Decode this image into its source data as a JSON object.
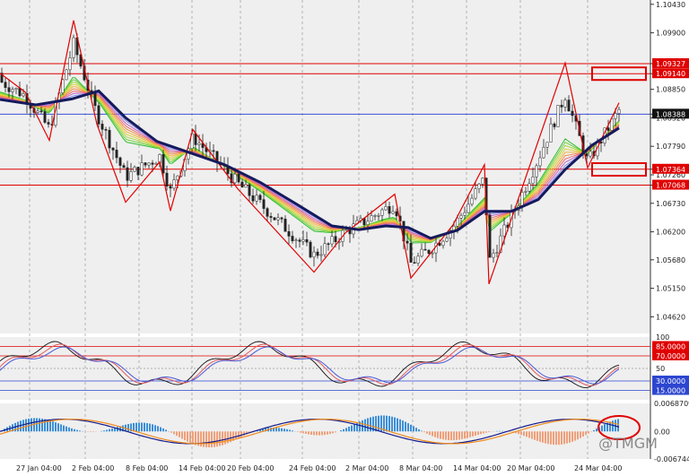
{
  "chart_data": {
    "type": "line",
    "main": {
      "price_ticks": [
        "1.10430",
        "1.09900",
        "1.09327",
        "1.09140",
        "1.08850",
        "1.08388",
        "1.08320",
        "1.07790",
        "1.07364",
        "1.07260",
        "1.07068",
        "1.06730",
        "1.06200",
        "1.05680",
        "1.05150",
        "1.04620"
      ],
      "price_ylim": [
        1.0431,
        1.1051
      ],
      "highlight_labels": [
        {
          "text": "1.09327",
          "value": 1.09327,
          "style": "red"
        },
        {
          "text": "1.09140",
          "value": 1.0914,
          "style": "red"
        },
        {
          "text": "1.08388",
          "value": 1.08388,
          "style": "dark"
        },
        {
          "text": "1.07364",
          "value": 1.07364,
          "style": "red"
        },
        {
          "text": "1.07068",
          "value": 1.07068,
          "style": "red"
        }
      ],
      "horizontal_lines": [
        {
          "value": 1.09327,
          "color": "#e00000"
        },
        {
          "value": 1.0914,
          "color": "#e00000"
        },
        {
          "value": 1.08388,
          "color": "#3a4fd8"
        },
        {
          "value": 1.07364,
          "color": "#e00000"
        },
        {
          "value": 1.07068,
          "color": "#e00000"
        }
      ],
      "marked_boxes": [
        {
          "value": 1.0914
        },
        {
          "value": 1.0736
        }
      ],
      "bold_ma": [
        [
          0,
          1.0866
        ],
        [
          40,
          1.0856
        ],
        [
          80,
          1.0867
        ],
        [
          110,
          1.0882
        ],
        [
          140,
          1.0832
        ],
        [
          175,
          1.0788
        ],
        [
          210,
          1.0768
        ],
        [
          250,
          1.0745
        ],
        [
          290,
          1.0712
        ],
        [
          330,
          1.0672
        ],
        [
          370,
          1.0631
        ],
        [
          400,
          1.0624
        ],
        [
          430,
          1.0631
        ],
        [
          455,
          1.0628
        ],
        [
          480,
          1.0608
        ],
        [
          510,
          1.0623
        ],
        [
          540,
          1.0658
        ],
        [
          570,
          1.0658
        ],
        [
          600,
          1.068
        ],
        [
          630,
          1.0736
        ],
        [
          660,
          1.0781
        ],
        [
          690,
          1.0813
        ]
      ],
      "zigzag": [
        [
          0,
          1.0915
        ],
        [
          28,
          1.088
        ],
        [
          55,
          1.079
        ],
        [
          82,
          1.1013
        ],
        [
          108,
          1.082
        ],
        [
          140,
          1.0675
        ],
        [
          178,
          1.075
        ],
        [
          190,
          1.0659
        ],
        [
          215,
          1.081
        ],
        [
          265,
          1.07
        ],
        [
          350,
          1.0545
        ],
        [
          385,
          1.0618
        ],
        [
          440,
          1.069
        ],
        [
          458,
          1.0534
        ],
        [
          505,
          1.0633
        ],
        [
          540,
          1.0745
        ],
        [
          545,
          1.0523
        ],
        [
          630,
          1.0934
        ],
        [
          655,
          1.0739
        ],
        [
          690,
          1.086
        ]
      ]
    },
    "oscillator": {
      "ticks": [
        "100",
        "85.0000",
        "70.0000",
        "50",
        "30.0000",
        "15.0000"
      ],
      "ylim": [
        0,
        100
      ],
      "levels": [
        {
          "value": 85,
          "label": "85.0000",
          "color": "#e00000"
        },
        {
          "value": 70,
          "label": "70.0000",
          "color": "#e00000"
        },
        {
          "value": 50,
          "label": "50",
          "color": "#999999"
        },
        {
          "value": 30,
          "label": "30.0000",
          "color": "#2d46d0"
        },
        {
          "value": 15,
          "label": "15.0000",
          "color": "#2d46d0"
        }
      ]
    },
    "macd": {
      "ticks": [
        "0.0068709",
        "0.00",
        "-0.0067446"
      ],
      "ylim": [
        -0.0067446,
        0.0068709
      ]
    },
    "x_labels": [
      "27 Jan 04:00",
      "2 Feb 04:00",
      "8 Feb 04:00",
      "14 Feb 04:00",
      "20 Feb 04:00",
      "24 Feb 04:00",
      "2 Mar 04:00",
      "8 Mar 04:00",
      "14 Mar 04:00",
      "20 Mar 04:00",
      "24 Mar 04:00"
    ],
    "watermark": "@TMGM"
  }
}
